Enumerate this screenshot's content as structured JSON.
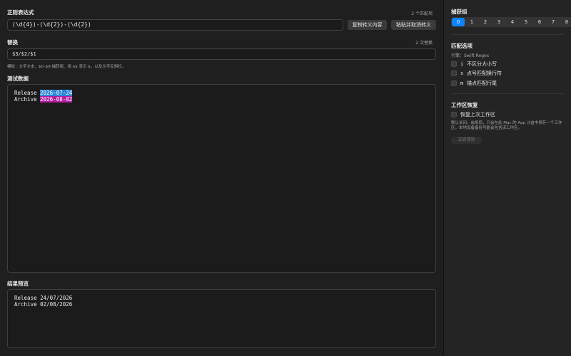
{
  "main": {
    "regex": {
      "title": "正则表达式",
      "match_count": "2 个匹配项",
      "value": "(\\d{4})-(\\d{2})-(\\d{2})",
      "copy_button": "复制转义内容",
      "paste_button": "粘贴并取消转义"
    },
    "replace": {
      "title": "替换",
      "count": "2 次替换",
      "value": "$3/$2/$1",
      "hint": "模板：文字文本、$0–$9 捕获组、用 $$ 表示 $，以及文字反斜杠。"
    },
    "test": {
      "title": "测试数据",
      "lines": [
        {
          "prefix": "Release ",
          "match": "2026-07-24"
        },
        {
          "prefix": "Archive ",
          "match": "2026-08-02"
        }
      ],
      "highlight_colors": [
        "#2b84d4",
        "#b31d9e"
      ]
    },
    "result": {
      "title": "结果预览",
      "lines": [
        "Release 24/07/2026",
        "Archive 02/08/2026"
      ]
    }
  },
  "sidebar": {
    "capture_groups": {
      "title": "捕获组",
      "items": [
        "0",
        "1",
        "2",
        "3",
        "4",
        "5",
        "6",
        "7",
        "8"
      ],
      "selected": "0",
      "accent": "#0a84ff"
    },
    "match_options": {
      "title": "匹配选项",
      "engine": "引擎：Swift Regex",
      "options": [
        {
          "key": "i",
          "label": "不区分大小写",
          "checked": false
        },
        {
          "key": "s",
          "label": "点号匹配换行符",
          "checked": false
        },
        {
          "key": "m",
          "label": "锚点匹配行尾",
          "checked": false
        }
      ]
    },
    "workspace": {
      "title": "工作区恢复",
      "restore_label": "恢复上次工作区",
      "restore_checked": false,
      "description": "默认关闭。启用后，只会在此 Mac 的 App 沙盒中保存一个工作区。本地设备备份可能会包含该工作区。",
      "clear_button": "立即清除"
    }
  }
}
